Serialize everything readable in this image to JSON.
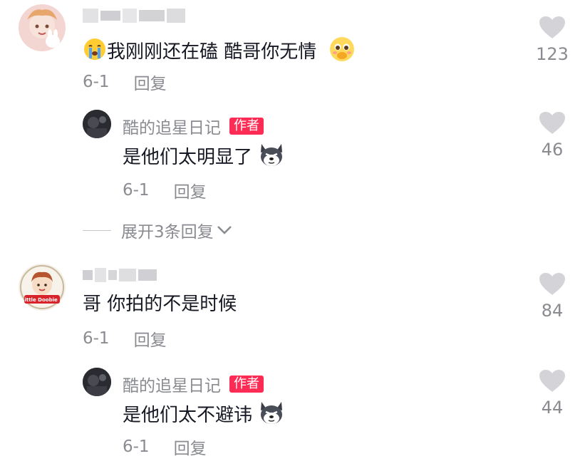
{
  "colors": {
    "text": "#161823",
    "muted": "#8a8b91",
    "badge": "#fe2c55",
    "like": "#d4d4d8"
  },
  "comments": [
    {
      "text": "我刚刚还在磕 酷哥你无情",
      "date": "6-1",
      "reply_label": "回复",
      "likes": "123",
      "emoji_before": "crying-face-icon",
      "emoji_after": "pleading-face-icon",
      "replies": [
        {
          "author": "酷的追星日记",
          "badge": "作者",
          "text": "是他们太明显了",
          "date": "6-1",
          "reply_label": "回复",
          "likes": "46",
          "emoji_after": "husky-dog-icon"
        }
      ],
      "expand_label": "展开3条回复"
    },
    {
      "text": "哥 你拍的不是时候",
      "date": "6-1",
      "reply_label": "回复",
      "likes": "84",
      "avatar_text": "Little Doobie",
      "replies": [
        {
          "author": "酷的追星日记",
          "badge": "作者",
          "text": "是他们太不避讳",
          "date": "6-1",
          "reply_label": "回复",
          "likes": "44",
          "emoji_after": "husky-dog-icon"
        }
      ]
    }
  ]
}
